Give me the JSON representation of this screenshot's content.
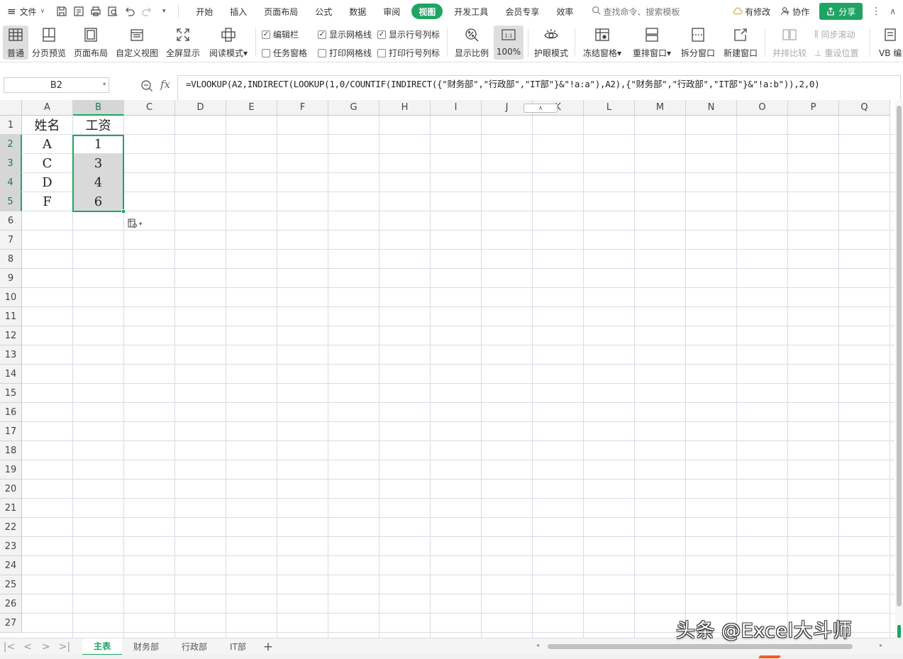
{
  "menubar": {
    "file_label": "文件",
    "tabs": [
      "开始",
      "插入",
      "页面布局",
      "公式",
      "数据",
      "审阅",
      "视图",
      "开发工具",
      "会员专享",
      "效率"
    ],
    "active_tab": "视图",
    "search_placeholder": "查找命令、搜索模板",
    "modified_label": "有修改",
    "collab_label": "协作",
    "share_label": "分享"
  },
  "ribbon": {
    "buttons": {
      "normal": "普通",
      "page_break_preview": "分页预览",
      "page_layout": "页面布局",
      "custom_view": "自定义视图",
      "full_screen": "全屏显示",
      "reading_mode": "阅读模式",
      "zoom_ratio": "显示比例",
      "zoom_100": "100%",
      "eye_protection": "护眼模式",
      "freeze_panes": "冻结窗格",
      "arrange_windows": "重排窗口",
      "split_window": "拆分窗口",
      "new_window": "新建窗口",
      "side_by_side": "并排比较",
      "sync_scroll": "同步滚动",
      "reset_position": "重设位置",
      "vb": "VB 编"
    },
    "checkboxes": {
      "edit_bar": {
        "label": "编辑栏",
        "checked": true
      },
      "show_gridlines": {
        "label": "显示网格线",
        "checked": true
      },
      "show_headings": {
        "label": "显示行号列标",
        "checked": true
      },
      "task_pane": {
        "label": "任务窗格",
        "checked": false
      },
      "print_gridlines": {
        "label": "打印网格线",
        "checked": false
      },
      "print_headings": {
        "label": "打印行号列标",
        "checked": false
      }
    }
  },
  "formula_bar": {
    "name_box": "B2",
    "fx_label": "fx",
    "formula": "=VLOOKUP(A2,INDIRECT(LOOKUP(1,0/COUNTIF(INDIRECT({\"财务部\",\"行政部\",\"IT部\"}&\"!a:a\"),A2),{\"财务部\",\"行政部\",\"IT部\"}&\"!a:b\")),2,0)"
  },
  "grid": {
    "columns": [
      "A",
      "B",
      "C",
      "D",
      "E",
      "F",
      "G",
      "H",
      "I",
      "J",
      "K",
      "L",
      "M",
      "N",
      "O",
      "P",
      "Q"
    ],
    "rows": [
      "1",
      "2",
      "3",
      "4",
      "5",
      "6",
      "7",
      "8",
      "9",
      "10",
      "11",
      "12",
      "13",
      "14",
      "15",
      "16",
      "17",
      "18",
      "19",
      "20",
      "21",
      "22",
      "23",
      "24",
      "25",
      "26",
      "27"
    ],
    "selected_column": "B",
    "selected_rows": [
      "2",
      "3",
      "4",
      "5"
    ],
    "cells": [
      {
        "row": 1,
        "col": "A",
        "value": "姓名"
      },
      {
        "row": 1,
        "col": "B",
        "value": "工资"
      },
      {
        "row": 2,
        "col": "A",
        "value": "A"
      },
      {
        "row": 2,
        "col": "B",
        "value": "1"
      },
      {
        "row": 3,
        "col": "A",
        "value": "C"
      },
      {
        "row": 3,
        "col": "B",
        "value": "3"
      },
      {
        "row": 4,
        "col": "A",
        "value": "D"
      },
      {
        "row": 4,
        "col": "B",
        "value": "4"
      },
      {
        "row": 5,
        "col": "A",
        "value": "F"
      },
      {
        "row": 5,
        "col": "B",
        "value": "6"
      }
    ]
  },
  "sheets": {
    "tabs": [
      "主表",
      "财务部",
      "行政部",
      "IT部"
    ],
    "active": "主表"
  },
  "watermark": "头条 @Excel大斗师",
  "colors": {
    "accent": "#1fa463",
    "selection_fill": "#d9d9d9",
    "gridline": "#dadce6"
  }
}
